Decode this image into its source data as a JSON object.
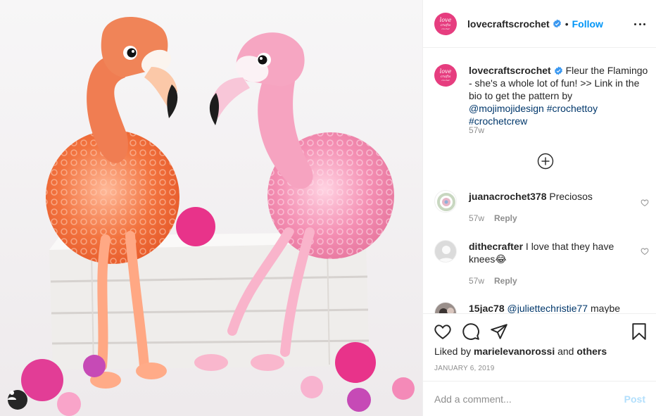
{
  "post": {
    "username": "lovecraftscrochet",
    "follow_label": "Follow",
    "separator": "•",
    "avatar_text": [
      "love",
      "crafts",
      "crochet"
    ],
    "caption": {
      "text": "Fleur the Flamingo - she's a whole lot of fun! >> Link in the bio to get the pattern by ",
      "mention": "@mojimojidesign",
      "hashtags": [
        "#crochettoy",
        "#crochetcrew"
      ],
      "time": "57w"
    },
    "comments": [
      {
        "username": "juanacrochet378",
        "text": "Preciosos",
        "time": "57w",
        "reply_label": "Reply"
      },
      {
        "username": "dithecrafter",
        "text": "I love that they have knees😂",
        "time": "57w",
        "reply_label": "Reply"
      },
      {
        "username": "15jac78",
        "mention": "@juliettechristie77",
        "text": "maybe",
        "time": "",
        "reply_label": ""
      }
    ],
    "liked_by_prefix": "Liked by",
    "liked_by_user": "marielevanorossi",
    "liked_by_and": "and",
    "liked_by_others": "others",
    "date": "JANUARY 6, 2019",
    "add_comment_placeholder": "Add a comment...",
    "post_label": "Post"
  },
  "colors": {
    "accent": "#0095f6",
    "brand_pink": "#e63d7f",
    "text": "#262626",
    "muted": "#8e8e8e"
  },
  "icons": [
    "verified-badge-icon",
    "more-options-icon",
    "load-more-plus-icon",
    "heart-icon",
    "comment-icon",
    "share-icon",
    "bookmark-icon",
    "user-tag-icon"
  ]
}
